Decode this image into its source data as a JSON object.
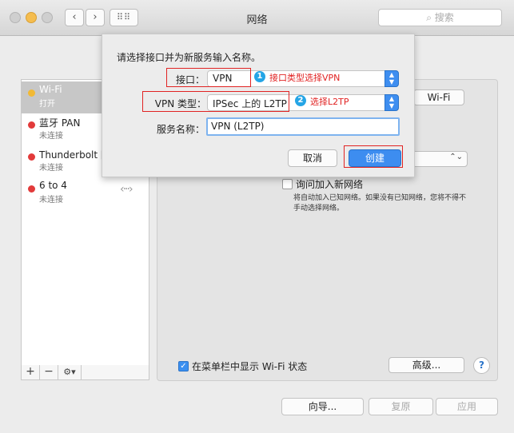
{
  "window": {
    "title": "网络"
  },
  "search": {
    "placeholder": "搜索"
  },
  "services": [
    {
      "name": "Wi-Fi",
      "status": "打开",
      "color": "yellow"
    },
    {
      "name": "蓝牙 PAN",
      "status": "未连接",
      "color": "red"
    },
    {
      "name": "Thunderbolt 网",
      "status": "未连接",
      "color": "red"
    },
    {
      "name": "6 to 4",
      "status": "未连接",
      "color": "red"
    }
  ],
  "sidebar_tools": {
    "add": "+",
    "remove": "−",
    "gear": "⚙▾"
  },
  "panel": {
    "wifi_button": "Wi-Fi",
    "ask_join_label": "询问加入新网络",
    "ask_join_note": "将自动加入已知网络。如果没有已知网络，您将不得不手动选择网络。",
    "show_in_menubar_label": "在菜单栏中显示 Wi-Fi 状态",
    "advanced_button": "高级...",
    "help": "?"
  },
  "bottom": {
    "assist": "向导...",
    "revert": "复原",
    "apply": "应用"
  },
  "dialog": {
    "prompt": "请选择接口并为新服务输入名称。",
    "interface_label": "接口：",
    "interface_value": "VPN",
    "vpn_type_label": "VPN 类型：",
    "vpn_type_value": "IPSec 上的 L2TP",
    "service_name_label": "服务名称：",
    "service_name_value": "VPN (L2TP)",
    "cancel": "取消",
    "create": "创建"
  },
  "annotations": [
    {
      "num": "1",
      "text": "接口类型选择VPN"
    },
    {
      "num": "2",
      "text": "选择L2TP"
    }
  ],
  "colors": {
    "accent": "#3d8df0",
    "annotation": "#e12323",
    "badge": "#25a5e6"
  }
}
